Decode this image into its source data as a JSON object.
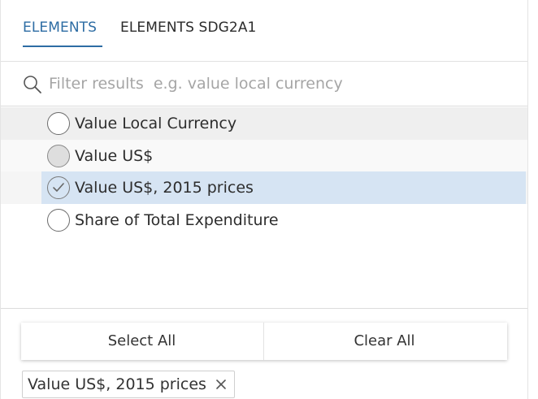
{
  "tabs": [
    {
      "label": "ELEMENTS",
      "active": true
    },
    {
      "label": "ELEMENTS SDG2A1",
      "active": false
    }
  ],
  "search": {
    "placeholder": "Filter results  e.g. value local currency",
    "value": "",
    "icon": "search-icon"
  },
  "items": [
    {
      "label": "Value Local Currency",
      "state": "unselected"
    },
    {
      "label": "Value US$",
      "state": "partial"
    },
    {
      "label": "Value US$, 2015 prices",
      "state": "selected"
    },
    {
      "label": "Share of Total Expenditure",
      "state": "unselected"
    }
  ],
  "buttons": {
    "select_all": "Select All",
    "clear_all": "Clear All"
  },
  "selected_chips": [
    {
      "label": "Value US$, 2015 prices",
      "remove_icon": "close-icon"
    }
  ],
  "colors": {
    "accent": "#2e6da4",
    "selected_row": "#d6e4f3",
    "hover_row": "#efefef",
    "alt_row": "#f9f9f9"
  }
}
